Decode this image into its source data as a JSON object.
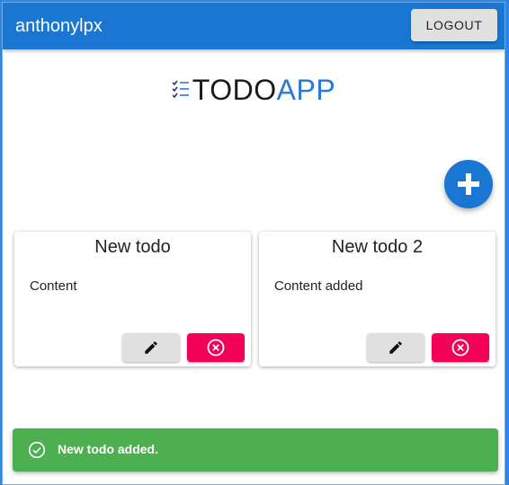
{
  "header": {
    "username": "anthonylpx",
    "logout_label": "LOGOUT"
  },
  "logo": {
    "text_primary": "TODO",
    "text_accent": "APP",
    "icon": "checklist-icon"
  },
  "fab": {
    "icon": "plus-icon"
  },
  "todos": [
    {
      "title": "New todo",
      "content": "Content",
      "edit_icon": "pencil-icon",
      "delete_icon": "close-circle-icon"
    },
    {
      "title": "New todo 2",
      "content": "Content added",
      "edit_icon": "pencil-icon",
      "delete_icon": "close-circle-icon"
    }
  ],
  "snackbar": {
    "message": "New todo added.",
    "icon": "check-circle-icon"
  },
  "colors": {
    "app_bar": "#1976d2",
    "accent": "#2b78d6",
    "delete": "#f50057",
    "success": "#4caf50",
    "button_grey": "#e0e0e0"
  }
}
